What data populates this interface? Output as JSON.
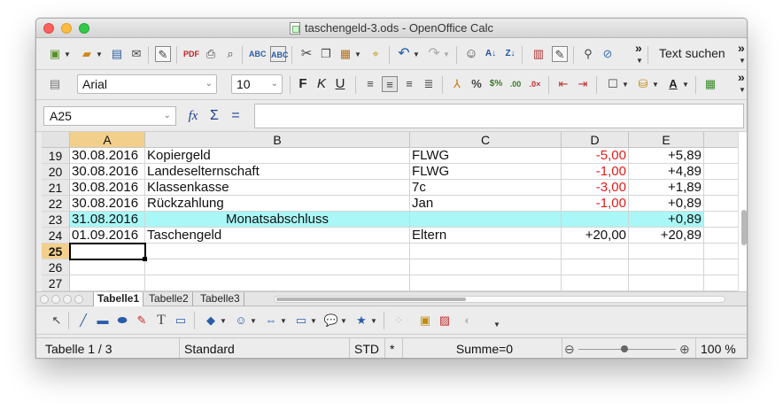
{
  "window": {
    "title": "taschengeld-3.ods - OpenOffice Calc"
  },
  "toolbar": {
    "overflow_glyph": "»",
    "find_text": "Text suchen"
  },
  "formatting": {
    "font_name": "Arial",
    "font_size": "10",
    "bold": "F",
    "italic": "K",
    "underline": "U"
  },
  "formula_bar": {
    "cell_ref": "A25",
    "fx": "fx",
    "sigma": "Σ",
    "equals": "="
  },
  "columns": [
    "A",
    "B",
    "C",
    "D",
    "E"
  ],
  "rows": [
    {
      "n": "19",
      "a": "30.08.2016",
      "b": "Kopiergeld",
      "c": "FLWG",
      "d": "-5,00",
      "e": "+5,89",
      "neg": true
    },
    {
      "n": "20",
      "a": "30.08.2016",
      "b": "Landeselternschaft",
      "c": "FLWG",
      "d": "-1,00",
      "e": "+4,89",
      "neg": true
    },
    {
      "n": "21",
      "a": "30.08.2016",
      "b": "Klassenkasse",
      "c": "7c",
      "d": "-3,00",
      "e": "+1,89",
      "neg": true
    },
    {
      "n": "22",
      "a": "30.08.2016",
      "b": "Rückzahlung",
      "c": "Jan",
      "d": "-1,00",
      "e": "+0,89",
      "neg": true
    },
    {
      "n": "23",
      "a": "31.08.2016",
      "b": "Monatsabschluss",
      "c": "",
      "d": "",
      "e": "+0,89",
      "neg": false
    },
    {
      "n": "24",
      "a": "01.09.2016",
      "b": "Taschengeld",
      "c": "Eltern",
      "d": "+20,00",
      "e": "+20,89",
      "neg": false
    },
    {
      "n": "25",
      "a": "",
      "b": "",
      "c": "",
      "d": "",
      "e": "",
      "neg": false
    },
    {
      "n": "26",
      "a": "",
      "b": "",
      "c": "",
      "d": "",
      "e": "",
      "neg": false
    },
    {
      "n": "27",
      "a": "",
      "b": "",
      "c": "",
      "d": "",
      "e": "",
      "neg": false
    }
  ],
  "sheet_tabs": [
    "Tabelle1",
    "Tabelle2",
    "Tabelle3"
  ],
  "status": {
    "sheet": "Tabelle 1 / 3",
    "style": "Standard",
    "mode": "STD",
    "modified": "*",
    "sum": "Summe=0",
    "zoom": "100 %"
  },
  "colors": {
    "selected_header": "#f2cf8b",
    "highlight_row": "#aaf7f7",
    "negative": "#e31b1b"
  }
}
